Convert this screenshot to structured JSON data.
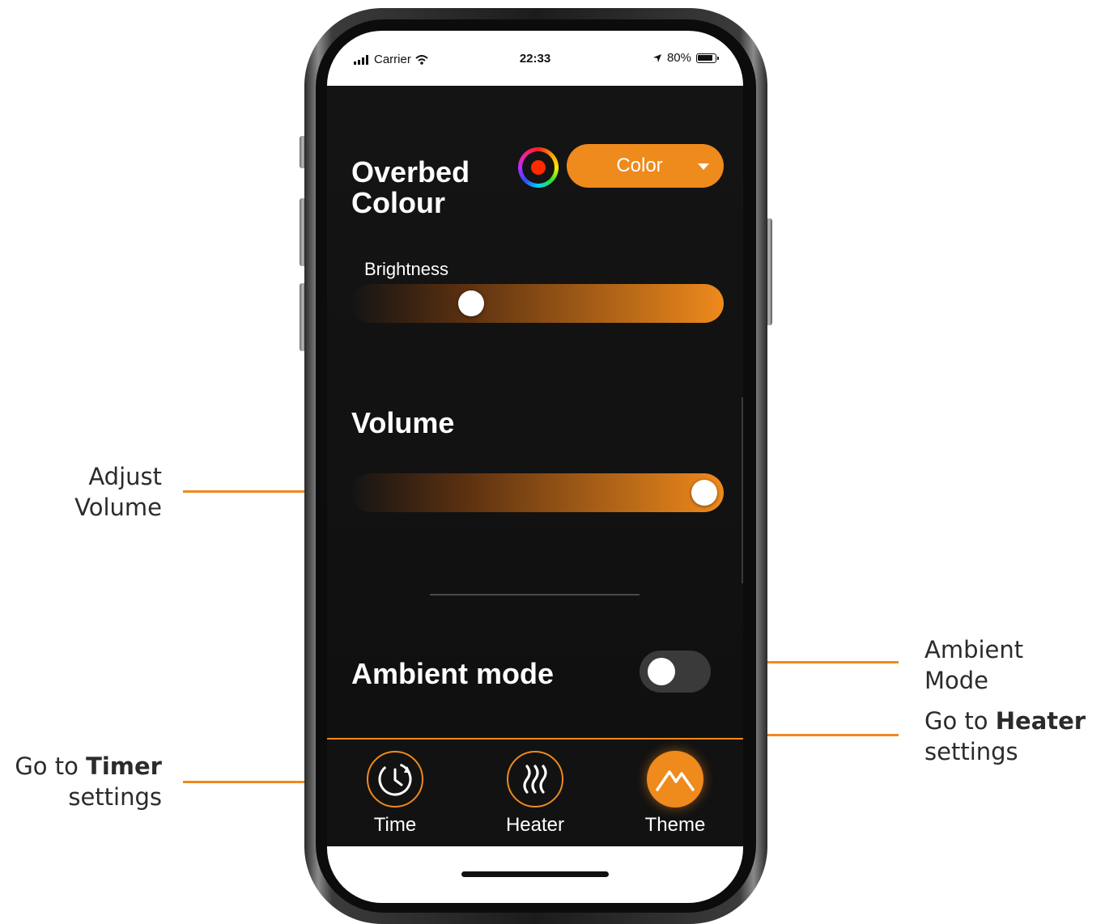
{
  "status_bar": {
    "carrier": "Carrier",
    "time": "22:33",
    "battery": "80%"
  },
  "overbed": {
    "title_line1": "Overbed",
    "title_line2": "Colour",
    "mode_select": "Color",
    "selected_color": "#ff2a00",
    "brightness_label": "Brightness",
    "brightness_value": 0.3
  },
  "volume": {
    "title": "Volume",
    "value": 1.0
  },
  "ambient": {
    "title": "Ambient mode",
    "enabled": false
  },
  "tabs": [
    {
      "label": "Time",
      "icon": "timer-icon",
      "active": false
    },
    {
      "label": "Heater",
      "icon": "heater-icon",
      "active": false
    },
    {
      "label": "Theme",
      "icon": "theme-mountain-icon",
      "active": true
    }
  ],
  "callouts": {
    "volume": {
      "line1": "Adjust",
      "line2": "Volume"
    },
    "ambient": {
      "line1": "Ambient",
      "line2": "Mode"
    },
    "heater": {
      "prefix": "Go to ",
      "bold": "Heater",
      "line2": "settings"
    },
    "timer": {
      "prefix": "Go to ",
      "bold": "Timer",
      "line2": "settings"
    }
  },
  "colors": {
    "accent": "#ef8a1c",
    "background": "#131313",
    "text": "#ffffff"
  }
}
